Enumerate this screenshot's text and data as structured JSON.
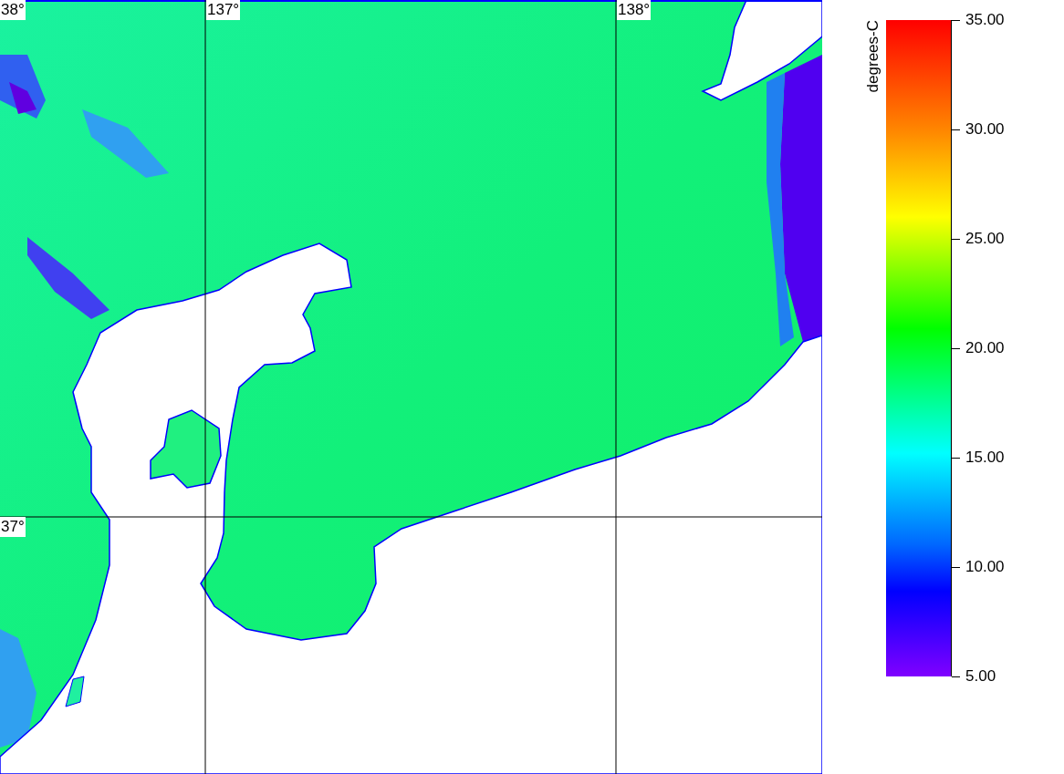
{
  "map": {
    "grid_labels": [
      {
        "kind": "latitude",
        "text": "38°"
      },
      {
        "kind": "latitude",
        "text": "37°"
      },
      {
        "kind": "longitude",
        "text": "137°"
      },
      {
        "kind": "longitude",
        "text": "138°"
      }
    ]
  },
  "colorbar": {
    "title": "degrees-C",
    "ticks": [
      "35.00",
      "30.00",
      "25.00",
      "20.00",
      "15.00",
      "10.00",
      "5.00"
    ]
  }
}
